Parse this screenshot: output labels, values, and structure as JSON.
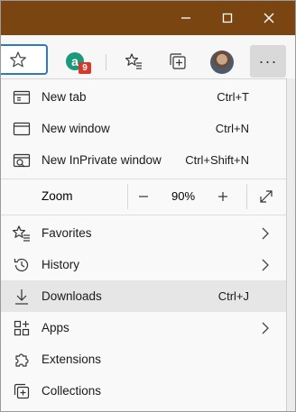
{
  "window": {
    "minimize_icon": "minimize-icon",
    "maximize_icon": "maximize-icon",
    "close_icon": "close-icon",
    "titlebar_color": "#7a4511"
  },
  "toolbar": {
    "extension_letter": "a",
    "extension_badge": "9",
    "more_label": "···"
  },
  "menu": {
    "new_tab": {
      "label": "New tab",
      "shortcut": "Ctrl+T"
    },
    "new_window": {
      "label": "New window",
      "shortcut": "Ctrl+N"
    },
    "new_inprivate": {
      "label": "New InPrivate window",
      "shortcut": "Ctrl+Shift+N"
    },
    "zoom": {
      "label": "Zoom",
      "value": "90%",
      "minus": "−",
      "plus": "+"
    },
    "favorites": {
      "label": "Favorites"
    },
    "history": {
      "label": "History"
    },
    "downloads": {
      "label": "Downloads",
      "shortcut": "Ctrl+J"
    },
    "apps": {
      "label": "Apps"
    },
    "extensions": {
      "label": "Extensions"
    },
    "collections": {
      "label": "Collections"
    }
  }
}
